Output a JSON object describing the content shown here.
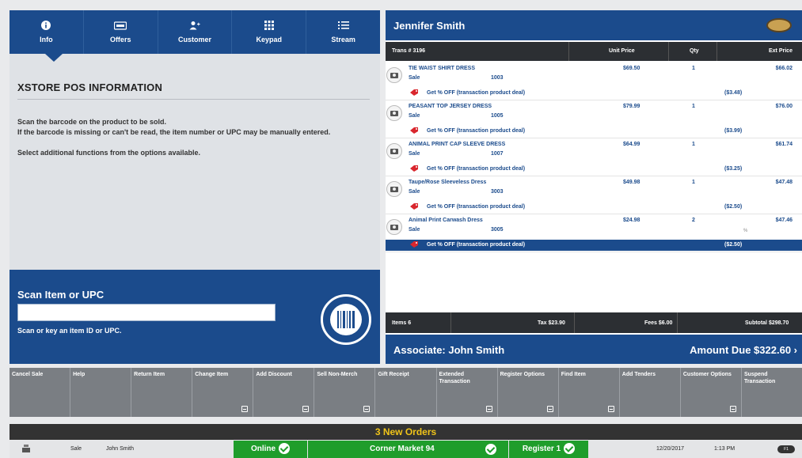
{
  "tabs": [
    {
      "label": "Info",
      "icon": "info-icon"
    },
    {
      "label": "Offers",
      "icon": "offers-icon"
    },
    {
      "label": "Customer",
      "icon": "customer-icon"
    },
    {
      "label": "Keypad",
      "icon": "keypad-icon"
    },
    {
      "label": "Stream",
      "icon": "stream-icon"
    }
  ],
  "info": {
    "title": "XSTORE POS INFORMATION",
    "line1": "Scan the barcode on the product to be sold.",
    "line2": "If the barcode is missing or can't be read, the item number or UPC may be manually entered.",
    "line3": "Select additional functions from the options available."
  },
  "scan": {
    "title": "Scan Item or UPC",
    "value": "",
    "hint": "Scan or key an item ID or UPC."
  },
  "customer": {
    "name": "Jennifer Smith"
  },
  "columns": {
    "trans": "Trans # 3196",
    "unit_price": "Unit Price",
    "qty": "Qty",
    "ext_price": "Ext Price"
  },
  "items": [
    {
      "name": "TIE WAIST SHIRT DRESS",
      "type": "Sale",
      "sku": "1003",
      "price": "$69.50",
      "qty": "1",
      "ext": "$66.02",
      "deal": "Get % OFF (transaction product deal)",
      "deal_amt": "($3.48)"
    },
    {
      "name": "PEASANT TOP JERSEY DRESS",
      "type": "Sale",
      "sku": "1005",
      "price": "$79.99",
      "qty": "1",
      "ext": "$76.00",
      "deal": "Get % OFF (transaction product deal)",
      "deal_amt": "($3.99)"
    },
    {
      "name": "ANIMAL PRINT CAP SLEEVE DRESS",
      "type": "Sale",
      "sku": "1007",
      "price": "$64.99",
      "qty": "1",
      "ext": "$61.74",
      "deal": "Get % OFF (transaction product deal)",
      "deal_amt": "($3.25)"
    },
    {
      "name": "Taupe/Rose Sleeveless Dress",
      "type": "Sale",
      "sku": "3003",
      "price": "$49.98",
      "qty": "1",
      "ext": "$47.48",
      "deal": "Get % OFF (transaction product deal)",
      "deal_amt": "($2.50)"
    },
    {
      "name": "Animal Print Carwash Dress",
      "type": "Sale",
      "sku": "3005",
      "price": "$24.98",
      "qty": "2",
      "ext": "$47.46",
      "deal": "Get % OFF (transaction product deal)",
      "deal_amt": "($2.50)",
      "selected": true
    }
  ],
  "discount_mark": "%",
  "totals": {
    "items": "Items 6",
    "tax": "Tax $23.90",
    "fees": "Fees $6.00",
    "subtotal": "Subtotal $298.70"
  },
  "footer": {
    "associate": "Associate: John Smith",
    "amount_due": "Amount Due $322.60 ›"
  },
  "buttons": [
    {
      "label": "Cancel Sale",
      "menu": false
    },
    {
      "label": "Help",
      "menu": false
    },
    {
      "label": "Return Item",
      "menu": false
    },
    {
      "label": "Change Item",
      "menu": true
    },
    {
      "label": "Add Discount",
      "menu": true
    },
    {
      "label": "Sell Non-Merch",
      "menu": true
    },
    {
      "label": "Gift Receipt",
      "menu": false
    },
    {
      "label": "Extended Transaction",
      "menu": true
    },
    {
      "label": "Register Options",
      "menu": true
    },
    {
      "label": "Find Item",
      "menu": true
    },
    {
      "label": "Add Tenders",
      "menu": false
    },
    {
      "label": "Customer Options",
      "menu": true
    },
    {
      "label": "Suspend Transaction",
      "menu": false
    }
  ],
  "orders": {
    "text": "3 New Orders"
  },
  "status": {
    "mode": "Sale",
    "user": "John Smith",
    "online": "Online",
    "store": "Corner Market 94",
    "register": "Register 1",
    "date": "12/20/2017",
    "time": "1:13 PM",
    "toggle": "F1"
  },
  "colors": {
    "brand_blue": "#1b4b8c",
    "status_green": "#1f9d2b",
    "orders_yellow": "#f0c419"
  }
}
